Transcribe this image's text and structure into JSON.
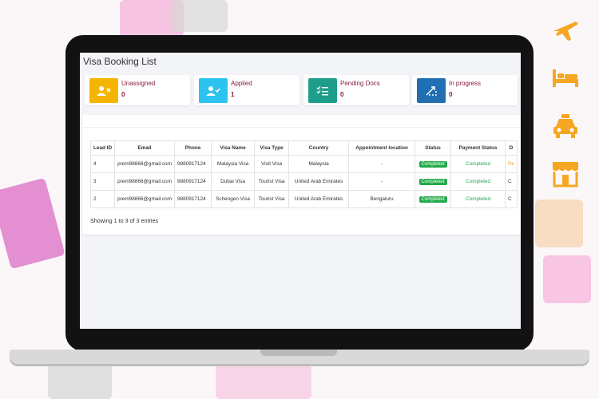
{
  "page_title": "Visa Booking List",
  "brand_color": "#f5a623",
  "stat_cards": [
    {
      "label": "Unassigned",
      "count": "0",
      "icon": "user-x-icon",
      "color": "#f5b400"
    },
    {
      "label": "Applied",
      "count": "1",
      "icon": "user-check-icon",
      "color": "#2cc3f0"
    },
    {
      "label": "Pending Docs",
      "count": "0",
      "icon": "list-check-icon",
      "color": "#1e9d8a"
    },
    {
      "label": "In progress",
      "count": "0",
      "icon": "progress-arrow-icon",
      "color": "#1f6fb2"
    }
  ],
  "table": {
    "headers": [
      "Lead ID",
      "Email",
      "Phone",
      "Visa Name",
      "Visa Type",
      "Country",
      "Appointment location",
      "Status",
      "Payment Status",
      "D"
    ],
    "rows": [
      {
        "lead_id": "4",
        "email": "prem98866@gmail.com",
        "phone": "9880917124",
        "visa_name": "Malaysia Visa",
        "visa_type": "Visit Visa",
        "country": "Malaysia",
        "appointment_location": "-",
        "status": "Completed",
        "payment_status": "Completed",
        "extra": "Pe"
      },
      {
        "lead_id": "3",
        "email": "prem98866@gmail.com",
        "phone": "9880917124",
        "visa_name": "Dubai Visa",
        "visa_type": "Tourist Visa",
        "country": "United Arab Emirates",
        "appointment_location": "-",
        "status": "Completed",
        "payment_status": "Completed",
        "extra": "C"
      },
      {
        "lead_id": "2",
        "email": "prem98866@gmail.com",
        "phone": "9880917124",
        "visa_name": "Schengen Visa",
        "visa_type": "Tourist Visa",
        "country": "United Arab Emirates",
        "appointment_location": "Bengaluru",
        "status": "Completed",
        "payment_status": "Completed",
        "extra": "C"
      }
    ]
  },
  "footer": "Showing 1 to 3 of 3 entries",
  "side_icons": [
    "airplane-icon",
    "bed-icon",
    "taxi-icon",
    "store-icon"
  ]
}
